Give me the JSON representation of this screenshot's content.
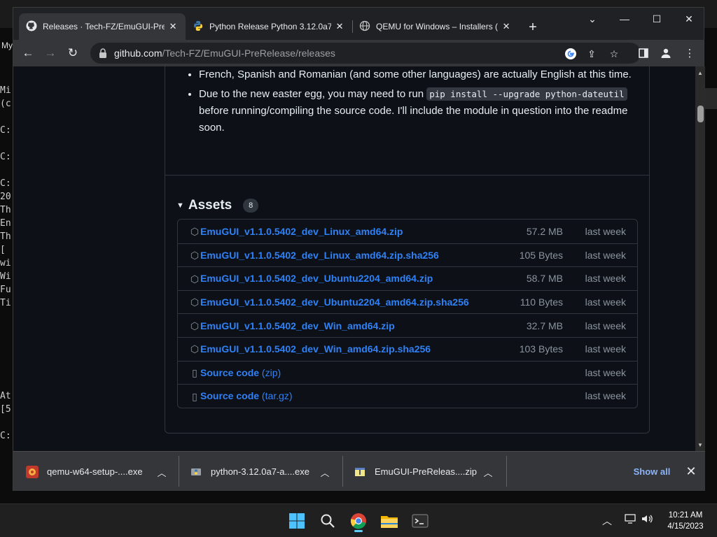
{
  "background": {
    "label_my": "My",
    "terminal_chars": [
      "Mi",
      "(c",
      "",
      "C:",
      "",
      "C:",
      "",
      "C:",
      "20",
      "Th",
      "En",
      "Th",
      "[",
      "wi",
      "Wi",
      "Fu",
      "Ti",
      "",
      "",
      "",
      "",
      "",
      "",
      "At",
      "[5",
      "",
      "C:"
    ]
  },
  "browser": {
    "tabs": [
      {
        "title": "Releases · Tech-FZ/EmuGUI-PreR",
        "icon": "github-icon",
        "active": true
      },
      {
        "title": "Python Release Python 3.12.0a7",
        "icon": "python-icon",
        "active": false
      },
      {
        "title": "QEMU for Windows – Installers (",
        "icon": "globe-icon",
        "active": false
      }
    ],
    "url_domain": "github.com",
    "url_path": "/Tech-FZ/EmuGUI-PreRelease/releases"
  },
  "release": {
    "notes": [
      {
        "text": "French, Spanish and Romanian (and some other languages) are actually English at this time."
      },
      {
        "before": "Due to the new easter egg, you may need to run ",
        "code": "pip install --upgrade python-dateutil",
        "after": " before running/compiling the source code. I'll include the module in question into the readme soon."
      }
    ],
    "assets_title": "Assets",
    "assets_count": "8",
    "assets": [
      {
        "name": "EmuGUI_v1.1.0.5402_dev_Linux_amd64.zip",
        "size": "57.2 MB",
        "date": "last week",
        "icon": "package-icon"
      },
      {
        "name": "EmuGUI_v1.1.0.5402_dev_Linux_amd64.zip.sha256",
        "size": "105 Bytes",
        "date": "last week",
        "icon": "package-icon"
      },
      {
        "name": "EmuGUI_v1.1.0.5402_dev_Ubuntu2204_amd64.zip",
        "size": "58.7 MB",
        "date": "last week",
        "icon": "package-icon"
      },
      {
        "name": "EmuGUI_v1.1.0.5402_dev_Ubuntu2204_amd64.zip.sha256",
        "size": "110 Bytes",
        "date": "last week",
        "icon": "package-icon"
      },
      {
        "name": "EmuGUI_v1.1.0.5402_dev_Win_amd64.zip",
        "size": "32.7 MB",
        "date": "last week",
        "icon": "package-icon"
      },
      {
        "name": "EmuGUI_v1.1.0.5402_dev_Win_amd64.zip.sha256",
        "size": "103 Bytes",
        "date": "last week",
        "icon": "package-icon"
      },
      {
        "name": "Source code",
        "sub": "(zip)",
        "size": "",
        "date": "last week",
        "icon": "file-zip-icon"
      },
      {
        "name": "Source code",
        "sub": "(tar.gz)",
        "size": "",
        "date": "last week",
        "icon": "file-zip-icon"
      }
    ]
  },
  "downloads": {
    "items": [
      {
        "name": "qemu-w64-setup-....exe",
        "icon": "qemu-installer-icon"
      },
      {
        "name": "python-3.12.0a7-a....exe",
        "icon": "python-installer-icon"
      },
      {
        "name": "EmuGUI-PreReleas....zip",
        "icon": "zip-archive-icon"
      }
    ],
    "show_all": "Show all"
  },
  "taskbar": {
    "time": "10:21 AM",
    "date": "4/15/2023"
  },
  "colors": {
    "link": "#2f81f7",
    "page_bg": "#0d1117",
    "border": "#30363d",
    "chrome_toolbar": "#35363a"
  }
}
